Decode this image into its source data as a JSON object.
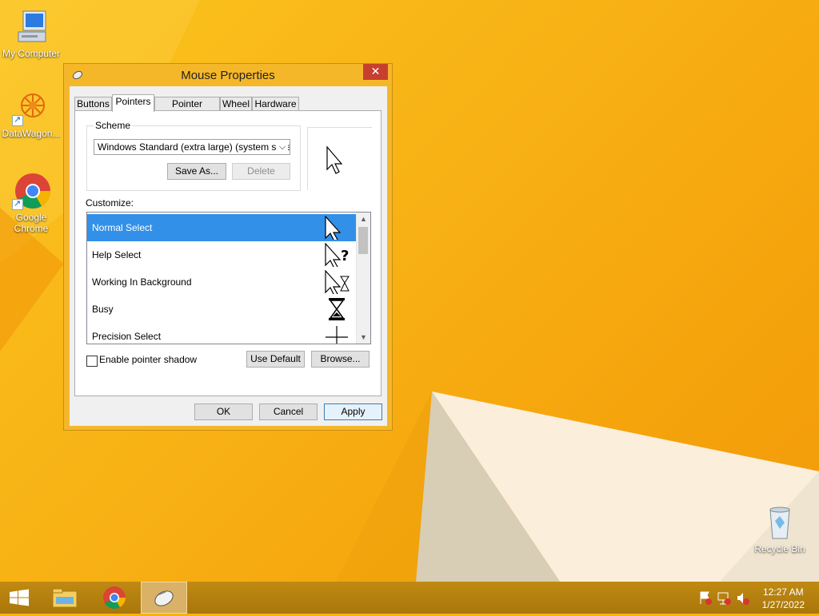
{
  "desktop": {
    "icons": [
      {
        "label": "My Computer"
      },
      {
        "label": "DataWagon..."
      },
      {
        "label": "Google Chrome"
      },
      {
        "label": "Recycle Bin"
      }
    ]
  },
  "dialog": {
    "title": "Mouse Properties",
    "close_glyph": "✕",
    "tabs": [
      {
        "label": "Buttons"
      },
      {
        "label": "Pointers"
      },
      {
        "label": "Pointer Options"
      },
      {
        "label": "Wheel"
      },
      {
        "label": "Hardware"
      }
    ],
    "active_tab": "Pointers",
    "scheme": {
      "legend": "Scheme",
      "selected": "Windows Standard (extra large) (system scheme)",
      "save_as_label": "Save As...",
      "delete_label": "Delete"
    },
    "customize_label": "Customize:",
    "pointer_list": [
      {
        "label": "Normal Select",
        "icon": "arrow-cursor-icon",
        "selected": true
      },
      {
        "label": "Help Select",
        "icon": "help-cursor-icon",
        "selected": false
      },
      {
        "label": "Working In Background",
        "icon": "working-cursor-icon",
        "selected": false
      },
      {
        "label": "Busy",
        "icon": "hourglass-cursor-icon",
        "selected": false
      },
      {
        "label": "Precision Select",
        "icon": "crosshair-cursor-icon",
        "selected": false
      }
    ],
    "shadow_label": "Enable pointer shadow",
    "shadow_checked": false,
    "use_default_label": "Use Default",
    "browse_label": "Browse...",
    "ok_label": "OK",
    "cancel_label": "Cancel",
    "apply_label": "Apply"
  },
  "taskbar": {
    "time": "12:27 AM",
    "date": "1/27/2022"
  },
  "colors": {
    "desktop_accent": "#f8b315",
    "selection": "#3390e9",
    "close_button": "#c7402f",
    "taskbar": "#b37e0c"
  }
}
